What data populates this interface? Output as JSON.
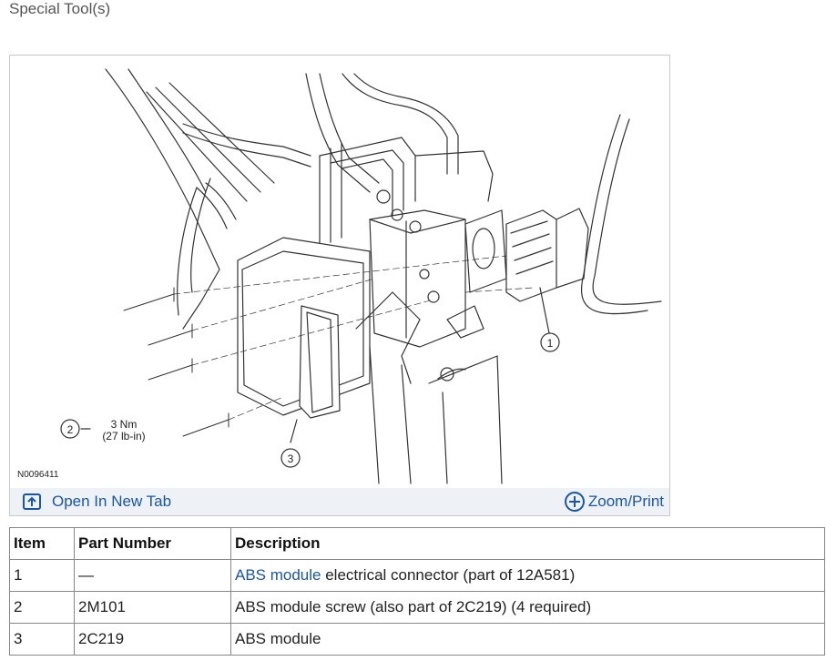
{
  "section_title": "Special Tool(s)",
  "figure": {
    "code": "N0096411",
    "callouts": {
      "c1": "1",
      "c2": "2",
      "c3": "3"
    },
    "torque_nm": "3 Nm",
    "torque_lbin": "(27 lb-in)",
    "open_new_tab_label": "Open In New Tab",
    "zoom_print_label": "Zoom/Print",
    "open_icon": "open-new-tab-icon",
    "zoom_icon": "plus-circle-icon",
    "link_color": "#1a56a6"
  },
  "table": {
    "headers": [
      "Item",
      "Part Number",
      "Description"
    ],
    "rows": [
      {
        "item": "1",
        "part": "—",
        "desc_link": "ABS module",
        "desc_rest": " electrical connector (part of 12A581)"
      },
      {
        "item": "2",
        "part": "2M101",
        "desc": "ABS module screw (also part of 2C219) (4 required)"
      },
      {
        "item": "3",
        "part": "2C219",
        "desc": "ABS module"
      }
    ]
  }
}
